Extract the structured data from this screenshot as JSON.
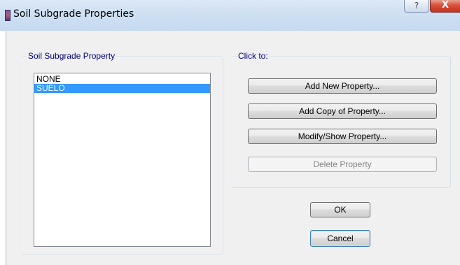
{
  "window": {
    "title": "Soil Subgrade Properties",
    "help_glyph": "?",
    "close_glyph": "X"
  },
  "property_group": {
    "legend": "Soil Subgrade Property",
    "items": [
      {
        "label": "NONE",
        "selected": false
      },
      {
        "label": "SUELO",
        "selected": true
      }
    ]
  },
  "actions_group": {
    "legend": "Click to:",
    "add_new": "Add New Property...",
    "add_copy": "Add Copy of Property...",
    "modify": "Modify/Show Property...",
    "delete": "Delete Property"
  },
  "dialog_buttons": {
    "ok": "OK",
    "cancel": "Cancel"
  },
  "colors": {
    "selection": "#3399ff",
    "legend_text": "#000080",
    "disabled_text": "#838383",
    "client_bg": "#f0f0f0"
  }
}
